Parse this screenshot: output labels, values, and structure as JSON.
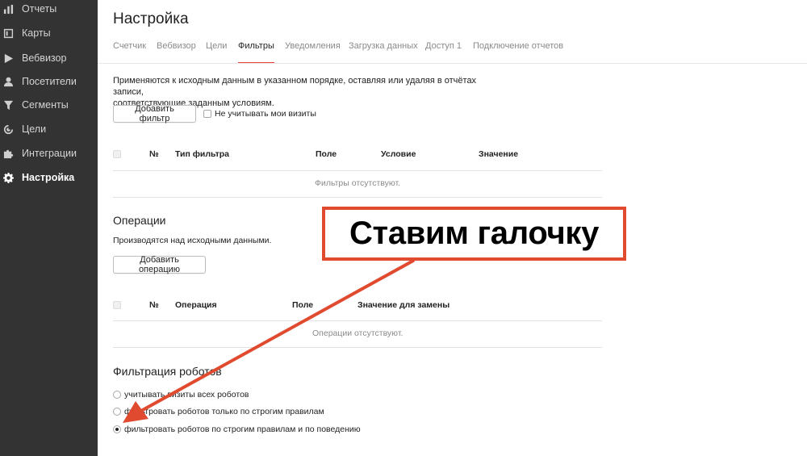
{
  "sidebar": {
    "items": [
      {
        "label": "Отчеты",
        "icon": "bar-chart-icon"
      },
      {
        "label": "Карты",
        "icon": "map-icon"
      },
      {
        "label": "Вебвизор",
        "icon": "play-icon"
      },
      {
        "label": "Посетители",
        "icon": "user-icon"
      },
      {
        "label": "Сегменты",
        "icon": "filter-icon"
      },
      {
        "label": "Цели",
        "icon": "target-icon"
      },
      {
        "label": "Интеграции",
        "icon": "puzzle-icon"
      },
      {
        "label": "Настройка",
        "icon": "gear-icon",
        "active": true
      }
    ]
  },
  "header": {
    "title": "Настройка",
    "tabs": [
      "Счетчик",
      "Вебвизор",
      "Цели",
      "Фильтры",
      "Уведомления",
      "Загрузка данных",
      "Доступ 1",
      "Подключение отчетов"
    ],
    "active_tab": "Фильтры"
  },
  "filters": {
    "description_line1": "Применяются к исходным данным в указанном порядке, оставляя или удаляя в отчётах записи,",
    "description_line2": "соответствующие заданным условиям.",
    "add_button": "Добавить фильтр",
    "ignore_my_visits": "Не учитывать мои визиты",
    "columns": [
      "№",
      "Тип фильтра",
      "Поле",
      "Условие",
      "Значение"
    ],
    "empty": "Фильтры отсутствуют."
  },
  "operations": {
    "title": "Операции",
    "description": "Производятся над исходными данными.",
    "add_button": "Добавить операцию",
    "columns": [
      "№",
      "Операция",
      "Поле",
      "Значение для замены"
    ],
    "empty": "Операции отсутствуют."
  },
  "robots": {
    "title": "Фильтрация роботов",
    "options": [
      "учитывать визиты всех роботов",
      "фильтровать роботов только по строгим правилам",
      "фильтровать роботов по строгим правилам и по поведению"
    ],
    "selected_index": 2
  },
  "callout": {
    "text": "Ставим галочку",
    "border_color": "#e04a2f",
    "arrow_color": "#e04a2f"
  },
  "colors": {
    "sidebar_bg": "#333333",
    "tab_underline": "#e8403f"
  }
}
